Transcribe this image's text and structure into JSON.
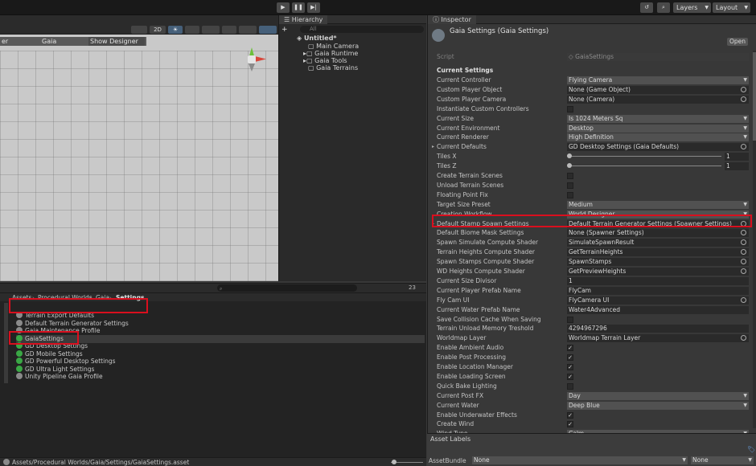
{
  "toolbar": {
    "play_icon": "play-icon",
    "pause_icon": "pause-icon",
    "step_icon": "step-icon",
    "history_icon": "history-icon",
    "search_icon": "search-icon",
    "layers_label": "Layers",
    "layout_label": "Layout"
  },
  "scene": {
    "mode_2d": "2D",
    "gaia_left_label": "er",
    "gaia_label": "Gaia",
    "show_designer_label": "Show Designer"
  },
  "hierarchy": {
    "tab_label": "Hierarchy",
    "add_label": "+",
    "search_placeholder": "All",
    "root": "Untitled*",
    "items": [
      "Main Camera",
      "Gaia Runtime",
      "Gaia Tools",
      "Gaia Terrains"
    ]
  },
  "inspector": {
    "tab_label": "Inspector",
    "title": "Gaia Settings (Gaia Settings)",
    "open_label": "Open",
    "script_label": "Script",
    "script_value": "GaiaSettings",
    "section_label": "Current Settings",
    "rows": [
      {
        "label": "Current Controller",
        "value": "Flying Camera"
      },
      {
        "label": "Custom Player Object",
        "value": "None (Game Object)"
      },
      {
        "label": "Custom Player Camera",
        "value": "None (Camera)"
      },
      {
        "label": "Instantiate Custom Controllers",
        "value": ""
      },
      {
        "label": "Current Size",
        "value": "Is 1024 Meters Sq"
      },
      {
        "label": "Current Environment",
        "value": "Desktop"
      },
      {
        "label": "Current Renderer",
        "value": "High Definition"
      },
      {
        "label": "Current Defaults",
        "value": "GD Desktop Settings (Gaia Defaults)"
      },
      {
        "label": "Tiles X",
        "value": "1"
      },
      {
        "label": "Tiles Z",
        "value": "1"
      },
      {
        "label": "Create Terrain Scenes",
        "value": ""
      },
      {
        "label": "Unload Terrain Scenes",
        "value": ""
      },
      {
        "label": "Floating Point Fix",
        "value": ""
      },
      {
        "label": "Target Size Preset",
        "value": "Medium"
      },
      {
        "label": "Creation Workflow",
        "value": "World Designer"
      },
      {
        "label": "Default Stamp Spawn Settings",
        "value": "Default Terrain Generator Settings (Spawner Settings)"
      },
      {
        "label": "Default Biome Mask Settings",
        "value": "None (Spawner Settings)"
      },
      {
        "label": "Spawn Simulate Compute Shader",
        "value": "SimulateSpawnResult"
      },
      {
        "label": "Terrain Heights Compute Shader",
        "value": "GetTerrainHeights"
      },
      {
        "label": "Spawn Stamps Compute Shader",
        "value": "SpawnStamps"
      },
      {
        "label": "WD Heights Compute Shader",
        "value": "GetPreviewHeights"
      },
      {
        "label": "Current Size Divisor",
        "value": "1"
      },
      {
        "label": "Current Player Prefab Name",
        "value": "FlyCam"
      },
      {
        "label": "Fly Cam UI",
        "value": "FlyCamera UI"
      },
      {
        "label": "Current Water Prefab Name",
        "value": "Water4Advanced"
      },
      {
        "label": "Save Collision Cache When Saving",
        "value": ""
      },
      {
        "label": "Terrain Unload Memory Treshold",
        "value": "4294967296"
      },
      {
        "label": "Worldmap Layer",
        "value": "Worldmap Terrain Layer"
      },
      {
        "label": "Enable Ambient Audio",
        "value": "✓"
      },
      {
        "label": "Enable Post Processing",
        "value": "✓"
      },
      {
        "label": "Enable Location Manager",
        "value": "✓"
      },
      {
        "label": "Enable Loading Screen",
        "value": "✓"
      },
      {
        "label": "Quick Bake Lighting",
        "value": ""
      },
      {
        "label": "Current Post FX",
        "value": "Day"
      },
      {
        "label": "Current Water",
        "value": "Deep Blue"
      },
      {
        "label": "Enable Underwater Effects",
        "value": "✓"
      },
      {
        "label": "Create Wind",
        "value": "✓"
      },
      {
        "label": "Wind Type",
        "value": "Calm"
      }
    ],
    "asset_labels_title": "Asset Labels",
    "asset_bundle_label": "AssetBundle",
    "asset_bundle_value": "None",
    "asset_variant_value": "None"
  },
  "project": {
    "breadcrumb": [
      "Assets",
      "Procedural Worlds",
      "Gaia",
      "Settings"
    ],
    "visible_count": "23",
    "files": [
      "Terrain Export Defaults",
      "Default Terrain Generator Settings",
      "Gaia Maintenance Profile",
      "GaiaSettings",
      "GD Desktop Settings",
      "GD Mobile Settings",
      "GD Powerful Desktop Settings",
      "GD Ultra Light Settings",
      "Unity Pipeline Gaia Profile"
    ],
    "status_path": "Assets/Procedural Worlds/Gaia/Settings/GaiaSettings.asset"
  }
}
